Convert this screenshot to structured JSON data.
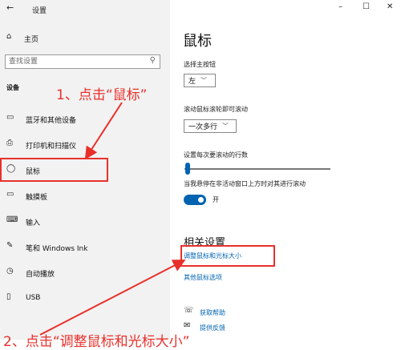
{
  "titlebar": {
    "back": "←",
    "title": "设置",
    "minimize": "–",
    "maximize": "☐",
    "close": "✕"
  },
  "sidebar": {
    "home": {
      "icon": "⌂",
      "label": "主页"
    },
    "search": {
      "placeholder": "查找设置",
      "icon": "⚲"
    },
    "section": "设备",
    "items": [
      {
        "icon": "▭",
        "label": "蓝牙和其他设备"
      },
      {
        "icon": "⎙",
        "label": "打印机和扫描仪"
      },
      {
        "icon": "◯",
        "label": "鼠标"
      },
      {
        "icon": "▭",
        "label": "触摸板"
      },
      {
        "icon": "⌨",
        "label": "输入"
      },
      {
        "icon": "✎",
        "label": "笔和 Windows Ink"
      },
      {
        "icon": "◷",
        "label": "自动播放"
      },
      {
        "icon": "▯",
        "label": "USB"
      }
    ]
  },
  "main": {
    "title": "鼠标",
    "primary_button": {
      "label": "选择主按钮",
      "value": "左"
    },
    "scroll": {
      "label": "滚动鼠标滚轮即可滚动",
      "value": "一次多行"
    },
    "lines": {
      "label": "设置每次要滚动的行数",
      "value": 3
    },
    "inactive_scroll": {
      "label": "当我悬停在非活动窗口上方时对其进行滚动",
      "state": "开"
    },
    "related": {
      "title": "相关设置",
      "links": [
        "调整鼠标和光标大小",
        "其他鼠标选项"
      ]
    },
    "help": [
      {
        "icon": "☏",
        "label": "获取帮助"
      },
      {
        "icon": "✉",
        "label": "提供反馈"
      }
    ]
  },
  "annotations": {
    "step1": "1、点击“鼠标”",
    "step2": "2、点击“调整鼠标和光标大小”"
  },
  "colors": {
    "accent": "#0063b1",
    "annotation": "#e8302b",
    "sidebar_bg": "#f2f2f2"
  }
}
